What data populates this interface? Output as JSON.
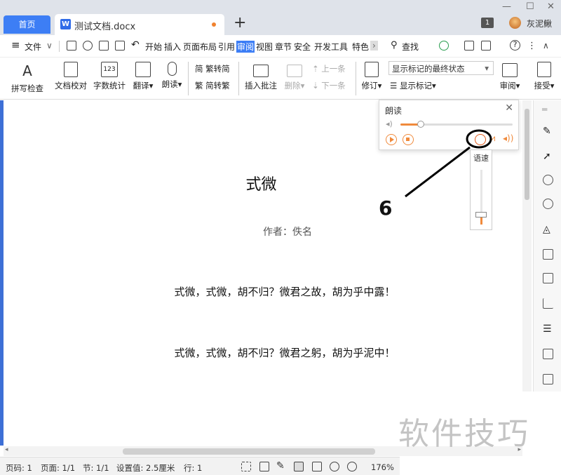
{
  "tabs": {
    "home": "首页",
    "doc_icon": "W",
    "doc_name": "测试文档.docx",
    "new_tab": "+"
  },
  "titlebar": {
    "badge": "1",
    "username": "灰泥鳅",
    "minimize": "—",
    "maximize": "☐",
    "close": "✕"
  },
  "menu": {
    "hamburger": "≡",
    "file": "文件",
    "file_arrow": "∨",
    "items": [
      "开始",
      "插入",
      "页面布局",
      "引用",
      "审阅",
      "视图",
      "章节",
      "安全",
      "开发工具",
      "特色"
    ],
    "active": "审阅",
    "more": "›",
    "search": "查找",
    "more_dots": "⋮",
    "collapse": "∧",
    "help": "?"
  },
  "ribbon": {
    "spell_check": "拼写检查",
    "doc_proof": "文档校对",
    "word_count": "字数统计",
    "translate": "翻译",
    "read_aloud": "朗读",
    "trad_simp": "繁转简",
    "simp_trad": "简转繁",
    "insert_comment": "插入批注",
    "delete": "删除",
    "prev": "上一条",
    "next": "下一条",
    "revise": "修订",
    "display_state": "显示标记的最终状态",
    "show_marks": "显示标记",
    "review": "审阅",
    "accept": "接受",
    "word_icon_text": "123"
  },
  "read_panel": {
    "title": "朗读",
    "close": "✕",
    "volume_level": 0.18
  },
  "speed_popover": {
    "title": "语速"
  },
  "annotation": {
    "number": "6"
  },
  "document": {
    "title": "式微",
    "author": "作者：佚名",
    "lines": [
      "式微，式微，胡不归？微君之故，胡为乎中露！",
      "式微，式微，胡不归？微君之躬，胡为乎泥中！"
    ]
  },
  "status": {
    "page_no": "页码: 1",
    "page": "页面: 1/1",
    "section": "节: 1/1",
    "setting": "设置值: 2.5厘米",
    "line": "行: 1",
    "zoom": "176%"
  },
  "watermark": "软件技巧"
}
